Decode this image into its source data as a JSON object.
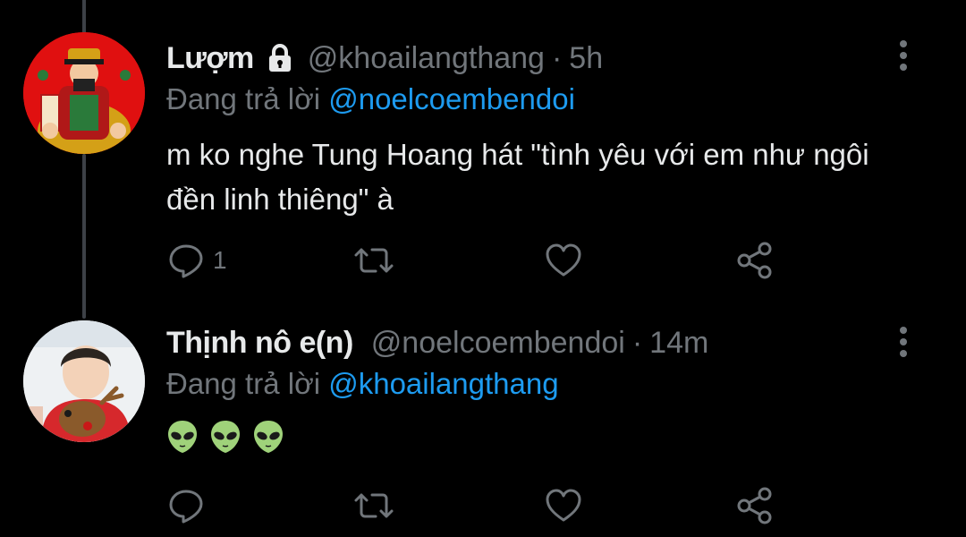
{
  "tweets": [
    {
      "display_name": "Lượm",
      "protected": true,
      "handle": "@khoailangthang",
      "separator": "·",
      "time": "5h",
      "replying_prefix": "Đang trả lời",
      "replying_to": "@noelcoembendoi",
      "text": "m ko nghe Tung Hoang hát \"tình yêu với em như ngôi đền linh thiêng\" à",
      "reply_count": "1",
      "avatar_icon": "god-of-wealth-avatar"
    },
    {
      "display_name": "Thịnh nô e(n)",
      "handle": "@noelcoembendoi",
      "separator": "·",
      "time": "14m",
      "replying_prefix": "Đang trả lời",
      "replying_to": "@khoailangthang",
      "emojis": [
        "👽",
        "👽",
        "👽"
      ],
      "reply_count": "",
      "avatar_icon": "person-with-reindeer-avatar"
    }
  ],
  "colors": {
    "background": "#000000",
    "text": "#e7e9ea",
    "muted": "#71767b",
    "link": "#1d9bf0"
  }
}
